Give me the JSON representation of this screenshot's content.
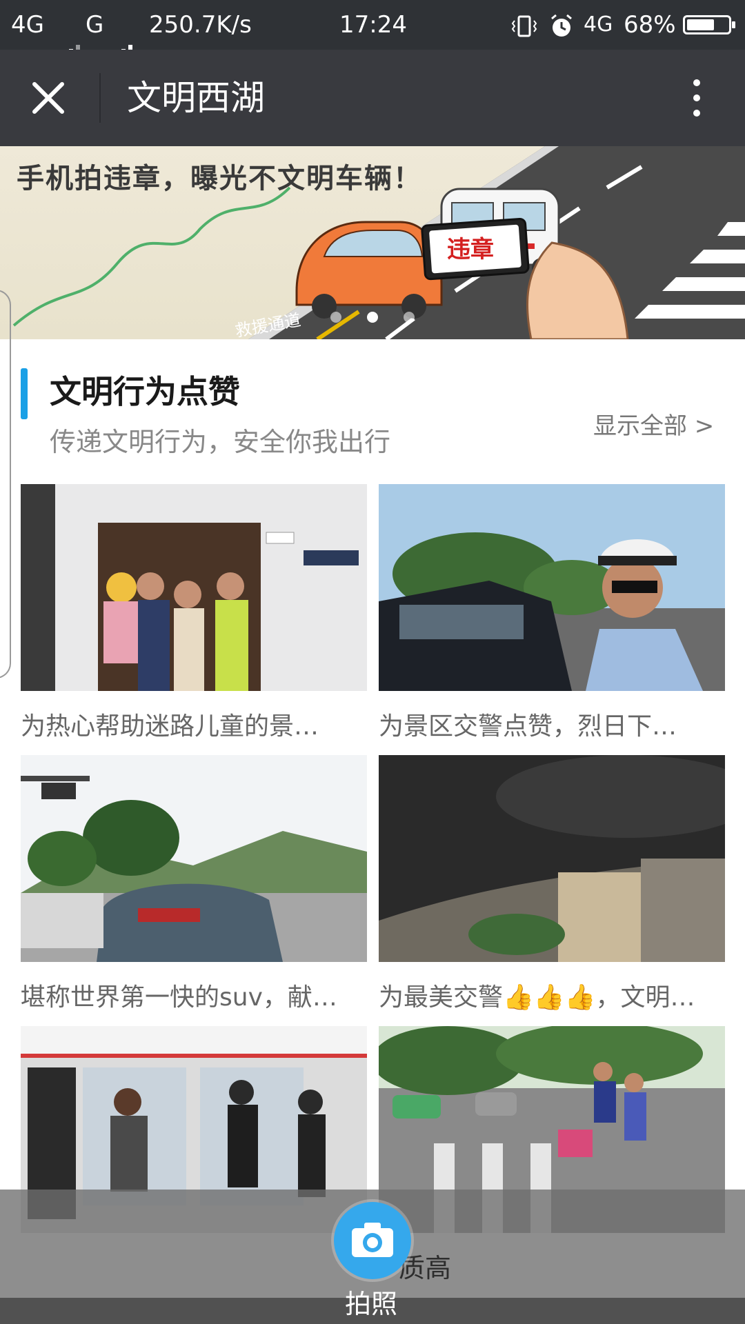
{
  "status_bar": {
    "network1": "4G",
    "network2": "G",
    "speed": "250.7K/s",
    "time": "17:24",
    "lte": "4G",
    "battery": "68%",
    "battery_level": 0.68
  },
  "nav": {
    "close_icon": "close-icon",
    "title": "文明西湖",
    "more_icon": "more-vertical-icon"
  },
  "banner": {
    "headline": "手机拍违章，曝光不文明车辆！",
    "badge_text": "违章",
    "road_text": "救援通道",
    "slides": 3,
    "active_slide": 1
  },
  "section": {
    "title": "文明行为点赞",
    "subtitle": "传递文明行为，安全你我出行",
    "show_all": "显示全部 >"
  },
  "cards": [
    {
      "caption": "为热心帮助迷路儿童的景…"
    },
    {
      "caption": "为景区交警点赞，烈日下…"
    },
    {
      "caption": "堪称世界第一快的suv，献…"
    },
    {
      "caption": "为最美交警👍👍👍，文明…"
    },
    {
      "caption": ""
    },
    {
      "caption": ""
    }
  ],
  "bottom": {
    "partial_caption": "质高",
    "camera_label": "拍照",
    "camera_icon": "camera-icon"
  },
  "colors": {
    "status_bg": "#2f3236",
    "nav_bg": "#393a3f",
    "accent": "#1aa0e6",
    "camera": "#35a8ec"
  }
}
